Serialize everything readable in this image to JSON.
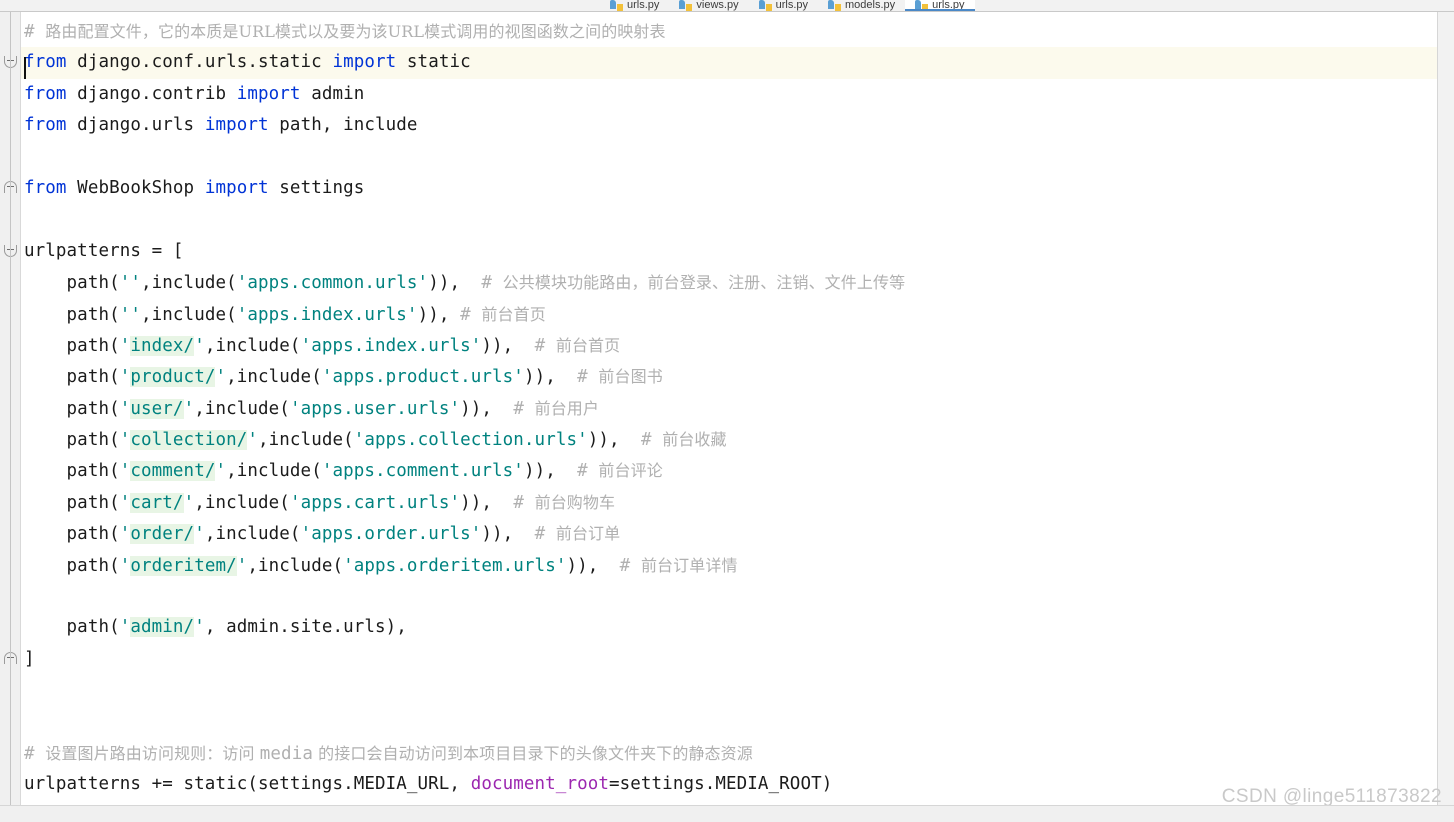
{
  "window": {
    "watermark": "CSDN @linge511873822",
    "accent_blue": "#4a88c7",
    "keyword_color": "#0033d6",
    "string_color": "#00827f",
    "comment_color": "#b0b0b0",
    "named_arg_color": "#9c27b0",
    "caret_line_bg": "#fcfaed",
    "string_highlight_bg": "#e8f5e5"
  },
  "tabs": [
    {
      "label": "urls.py",
      "icon": "python-file-icon",
      "active": false
    },
    {
      "label": "views.py",
      "icon": "python-file-icon",
      "active": false
    },
    {
      "label": "urls.py",
      "icon": "python-file-icon",
      "active": false
    },
    {
      "label": "models.py",
      "icon": "python-file-icon",
      "active": false
    },
    {
      "label": "urls.py",
      "icon": "python-file-icon",
      "active": true
    }
  ],
  "editor": {
    "language": "python",
    "filename": "urls.py",
    "lines": [
      {
        "n": 1,
        "fold": "none",
        "caret": false,
        "tokens": [
          {
            "t": "# ",
            "c": "cmthash"
          },
          {
            "t": "路由配置文件，它的本质是URL模式以及要为该URL模式调用的视图函数之间的映射表",
            "c": "cmt"
          }
        ]
      },
      {
        "n": 2,
        "fold": "open",
        "caret": true,
        "tokens": [
          {
            "t": "from",
            "c": "kw"
          },
          {
            "t": " django.conf.urls.static ",
            "c": "plain"
          },
          {
            "t": "import",
            "c": "kw"
          },
          {
            "t": " static",
            "c": "plain"
          }
        ]
      },
      {
        "n": 3,
        "fold": "none",
        "caret": false,
        "tokens": [
          {
            "t": "from",
            "c": "kw"
          },
          {
            "t": " django.contrib ",
            "c": "plain"
          },
          {
            "t": "import",
            "c": "kw"
          },
          {
            "t": " admin",
            "c": "plain"
          }
        ]
      },
      {
        "n": 4,
        "fold": "none",
        "caret": false,
        "tokens": [
          {
            "t": "from",
            "c": "kw"
          },
          {
            "t": " django.urls ",
            "c": "plain"
          },
          {
            "t": "import",
            "c": "kw"
          },
          {
            "t": " path, include",
            "c": "plain"
          }
        ]
      },
      {
        "n": 5,
        "fold": "none",
        "caret": false,
        "tokens": []
      },
      {
        "n": 6,
        "fold": "close",
        "caret": false,
        "tokens": [
          {
            "t": "from",
            "c": "kw"
          },
          {
            "t": " WebBookShop ",
            "c": "plain"
          },
          {
            "t": "import",
            "c": "kw"
          },
          {
            "t": " settings",
            "c": "plain"
          }
        ]
      },
      {
        "n": 7,
        "fold": "none",
        "caret": false,
        "tokens": []
      },
      {
        "n": 8,
        "fold": "open",
        "caret": false,
        "tokens": [
          {
            "t": "urlpatterns = [",
            "c": "plain"
          }
        ]
      },
      {
        "n": 9,
        "fold": "none",
        "caret": false,
        "tokens": [
          {
            "t": "    path(",
            "c": "plain"
          },
          {
            "t": "''",
            "c": "str"
          },
          {
            "t": ",include(",
            "c": "plain"
          },
          {
            "t": "'apps.common.urls'",
            "c": "str"
          },
          {
            "t": ")),  ",
            "c": "plain"
          },
          {
            "t": "# ",
            "c": "cmthash"
          },
          {
            "t": "公共模块功能路由，前台登录、注册、注销、文件上传等",
            "c": "cmt"
          }
        ]
      },
      {
        "n": 10,
        "fold": "none",
        "caret": false,
        "tokens": [
          {
            "t": "    path(",
            "c": "plain"
          },
          {
            "t": "''",
            "c": "str"
          },
          {
            "t": ",include(",
            "c": "plain"
          },
          {
            "t": "'apps.index.urls'",
            "c": "str"
          },
          {
            "t": ")), ",
            "c": "plain"
          },
          {
            "t": "# ",
            "c": "cmthash"
          },
          {
            "t": "前台首页",
            "c": "cmt"
          }
        ]
      },
      {
        "n": 11,
        "fold": "none",
        "caret": false,
        "tokens": [
          {
            "t": "    path(",
            "c": "plain"
          },
          {
            "t": "'",
            "c": "str"
          },
          {
            "t": "index/",
            "c": "str hl"
          },
          {
            "t": "'",
            "c": "str"
          },
          {
            "t": ",include(",
            "c": "plain"
          },
          {
            "t": "'apps.index.urls'",
            "c": "str"
          },
          {
            "t": ")),  ",
            "c": "plain"
          },
          {
            "t": "# ",
            "c": "cmthash"
          },
          {
            "t": "前台首页",
            "c": "cmt"
          }
        ]
      },
      {
        "n": 12,
        "fold": "none",
        "caret": false,
        "tokens": [
          {
            "t": "    path(",
            "c": "plain"
          },
          {
            "t": "'",
            "c": "str"
          },
          {
            "t": "product/",
            "c": "str hl"
          },
          {
            "t": "'",
            "c": "str"
          },
          {
            "t": ",include(",
            "c": "plain"
          },
          {
            "t": "'apps.product.urls'",
            "c": "str"
          },
          {
            "t": ")),  ",
            "c": "plain"
          },
          {
            "t": "# ",
            "c": "cmthash"
          },
          {
            "t": "前台图书",
            "c": "cmt"
          }
        ]
      },
      {
        "n": 13,
        "fold": "none",
        "caret": false,
        "tokens": [
          {
            "t": "    path(",
            "c": "plain"
          },
          {
            "t": "'",
            "c": "str"
          },
          {
            "t": "user/",
            "c": "str hl"
          },
          {
            "t": "'",
            "c": "str"
          },
          {
            "t": ",include(",
            "c": "plain"
          },
          {
            "t": "'apps.user.urls'",
            "c": "str"
          },
          {
            "t": ")),  ",
            "c": "plain"
          },
          {
            "t": "# ",
            "c": "cmthash"
          },
          {
            "t": "前台用户",
            "c": "cmt"
          }
        ]
      },
      {
        "n": 14,
        "fold": "none",
        "caret": false,
        "tokens": [
          {
            "t": "    path(",
            "c": "plain"
          },
          {
            "t": "'",
            "c": "str"
          },
          {
            "t": "collection/",
            "c": "str hl"
          },
          {
            "t": "'",
            "c": "str"
          },
          {
            "t": ",include(",
            "c": "plain"
          },
          {
            "t": "'apps.collection.urls'",
            "c": "str"
          },
          {
            "t": ")),  ",
            "c": "plain"
          },
          {
            "t": "# ",
            "c": "cmthash"
          },
          {
            "t": "前台收藏",
            "c": "cmt"
          }
        ]
      },
      {
        "n": 15,
        "fold": "none",
        "caret": false,
        "tokens": [
          {
            "t": "    path(",
            "c": "plain"
          },
          {
            "t": "'",
            "c": "str"
          },
          {
            "t": "comment/",
            "c": "str hl"
          },
          {
            "t": "'",
            "c": "str"
          },
          {
            "t": ",include(",
            "c": "plain"
          },
          {
            "t": "'apps.comment.urls'",
            "c": "str"
          },
          {
            "t": ")),  ",
            "c": "plain"
          },
          {
            "t": "# ",
            "c": "cmthash"
          },
          {
            "t": "前台评论",
            "c": "cmt"
          }
        ]
      },
      {
        "n": 16,
        "fold": "none",
        "caret": false,
        "tokens": [
          {
            "t": "    path(",
            "c": "plain"
          },
          {
            "t": "'",
            "c": "str"
          },
          {
            "t": "cart/",
            "c": "str hl"
          },
          {
            "t": "'",
            "c": "str"
          },
          {
            "t": ",include(",
            "c": "plain"
          },
          {
            "t": "'apps.cart.urls'",
            "c": "str"
          },
          {
            "t": ")),  ",
            "c": "plain"
          },
          {
            "t": "# ",
            "c": "cmthash"
          },
          {
            "t": "前台购物车",
            "c": "cmt"
          }
        ]
      },
      {
        "n": 17,
        "fold": "none",
        "caret": false,
        "tokens": [
          {
            "t": "    path(",
            "c": "plain"
          },
          {
            "t": "'",
            "c": "str"
          },
          {
            "t": "order/",
            "c": "str hl"
          },
          {
            "t": "'",
            "c": "str"
          },
          {
            "t": ",include(",
            "c": "plain"
          },
          {
            "t": "'apps.order.urls'",
            "c": "str"
          },
          {
            "t": ")),  ",
            "c": "plain"
          },
          {
            "t": "# ",
            "c": "cmthash"
          },
          {
            "t": "前台订单",
            "c": "cmt"
          }
        ]
      },
      {
        "n": 18,
        "fold": "none",
        "caret": false,
        "tokens": [
          {
            "t": "    path(",
            "c": "plain"
          },
          {
            "t": "'",
            "c": "str"
          },
          {
            "t": "orderitem/",
            "c": "str hl"
          },
          {
            "t": "'",
            "c": "str"
          },
          {
            "t": ",include(",
            "c": "plain"
          },
          {
            "t": "'apps.orderitem.urls'",
            "c": "str"
          },
          {
            "t": ")),  ",
            "c": "plain"
          },
          {
            "t": "# ",
            "c": "cmthash"
          },
          {
            "t": "前台订单详情",
            "c": "cmt"
          }
        ]
      },
      {
        "n": 19,
        "fold": "none",
        "caret": false,
        "tokens": []
      },
      {
        "n": 20,
        "fold": "none",
        "caret": false,
        "tokens": [
          {
            "t": "    path(",
            "c": "plain"
          },
          {
            "t": "'",
            "c": "str"
          },
          {
            "t": "admin/",
            "c": "str hl"
          },
          {
            "t": "'",
            "c": "str"
          },
          {
            "t": ", admin.site.urls),",
            "c": "plain"
          }
        ]
      },
      {
        "n": 21,
        "fold": "close",
        "caret": false,
        "tokens": [
          {
            "t": "]",
            "c": "plain"
          }
        ]
      },
      {
        "n": 22,
        "fold": "none",
        "caret": false,
        "tokens": []
      },
      {
        "n": 23,
        "fold": "none",
        "caret": false,
        "tokens": []
      },
      {
        "n": 24,
        "fold": "none",
        "caret": false,
        "tokens": [
          {
            "t": "# ",
            "c": "cmthash"
          },
          {
            "t": "设置图片路由访问规则：访问 ",
            "c": "cmt"
          },
          {
            "t": "media",
            "c": "cmthash"
          },
          {
            "t": " 的接口会自动访问到本项目目录下的头像文件夹下的静态资源",
            "c": "cmt"
          }
        ]
      },
      {
        "n": 25,
        "fold": "none",
        "caret": false,
        "tokens": [
          {
            "t": "urlpatterns += static(settings.MEDIA_URL, ",
            "c": "plain"
          },
          {
            "t": "document_root",
            "c": "named"
          },
          {
            "t": "=settings.MEDIA_ROOT)",
            "c": "plain"
          }
        ]
      }
    ]
  }
}
